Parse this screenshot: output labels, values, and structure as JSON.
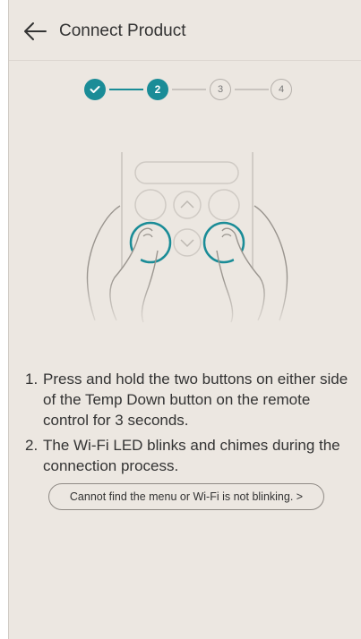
{
  "header": {
    "title": "Connect Product",
    "back_icon": "arrow-left-icon"
  },
  "stepper": {
    "steps": [
      {
        "label": "",
        "state": "done",
        "icon": "check-icon"
      },
      {
        "label": "2",
        "state": "active"
      },
      {
        "label": "3",
        "state": "todo"
      },
      {
        "label": "4",
        "state": "todo"
      }
    ],
    "colors": {
      "accent": "#1a8c97",
      "inactive": "#b5b0ab"
    }
  },
  "illustration": {
    "icon": "remote-hands-press-illustration"
  },
  "instructions": [
    {
      "num": "1.",
      "text": "Press and hold the two buttons on either side of the Temp Down button on the remote control for 3 seconds."
    },
    {
      "num": "2.",
      "text": "The Wi-Fi LED blinks and chimes during the connection process."
    }
  ],
  "help_link": {
    "label": "Cannot find the menu or Wi-Fi is not blinking. >"
  }
}
